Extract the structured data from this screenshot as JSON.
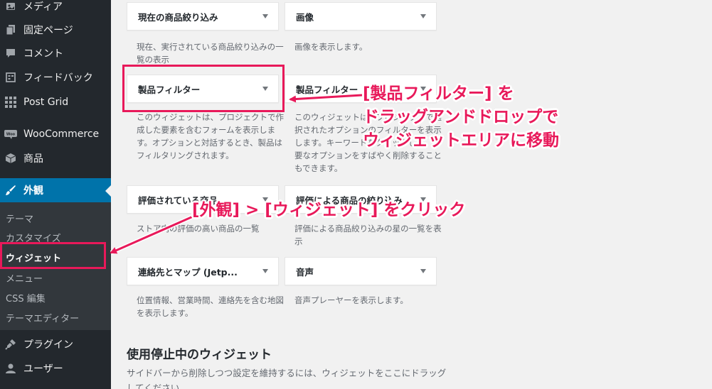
{
  "sidebar": {
    "items": [
      {
        "label": "メディア",
        "icon": "media-icon"
      },
      {
        "label": "固定ページ",
        "icon": "page-icon"
      },
      {
        "label": "コメント",
        "icon": "comment-icon"
      },
      {
        "label": "フィードバック",
        "icon": "feedback-icon"
      },
      {
        "label": "Post Grid",
        "icon": "grid-icon"
      },
      {
        "label": "WooCommerce",
        "icon": "woocommerce-icon"
      },
      {
        "label": "商品",
        "icon": "product-icon"
      },
      {
        "label": "外観",
        "icon": "brush-icon"
      },
      {
        "label": "プラグイン",
        "icon": "plugin-icon"
      },
      {
        "label": "ユーザー",
        "icon": "user-icon"
      }
    ],
    "submenu": [
      {
        "label": "テーマ"
      },
      {
        "label": "カスタマイズ"
      },
      {
        "label": "ウィジェット"
      },
      {
        "label": "メニュー"
      },
      {
        "label": "CSS 編集"
      },
      {
        "label": "テーマエディター"
      }
    ]
  },
  "widgets": [
    {
      "title": "現在の商品絞り込み",
      "desc": "現在、実行されている商品絞り込みの一覧の表示"
    },
    {
      "title": "画像",
      "desc": "画像を表示します。"
    },
    {
      "title": "製品フィルター",
      "desc": "このウィジェットは、プロジェクトで作成した要素を含むフォームを表示します。オプションと対話するとき、製品はフィルタリングされます。"
    },
    {
      "title": "製品フィルター",
      "desc": "このウィジェットは、プロジェクトで選択されたオプションのフィルターを表示します。キーワードをクリックして、必要なオプションをすばやく削除することもできます。"
    },
    {
      "title": "評価されている商品",
      "desc": "ストア内の評価の高い商品の一覧"
    },
    {
      "title": "評価による商品の絞り込み",
      "desc": "評価による商品絞り込みの星の一覧を表示"
    },
    {
      "title": "連絡先とマップ (Jetp...",
      "desc": "位置情報、営業時間、連絡先を含む地図を表示します。"
    },
    {
      "title": "音声",
      "desc": "音声プレーヤーを表示します。"
    }
  ],
  "inactive": {
    "title": "使用停止中のウィジェット",
    "desc": "サイドバーから削除しつつ設定を維持するには、ウィジェットをここにドラッグしてください。"
  },
  "annotations": {
    "callout1_line1": "[製品フィルター] を",
    "callout1_line2": "ドラッグアンドドロップで",
    "callout1_line3": "ウィジェットエリアに移動",
    "callout2": "[外観] > [ウィジェット] をクリック",
    "color": "#e8195a"
  }
}
